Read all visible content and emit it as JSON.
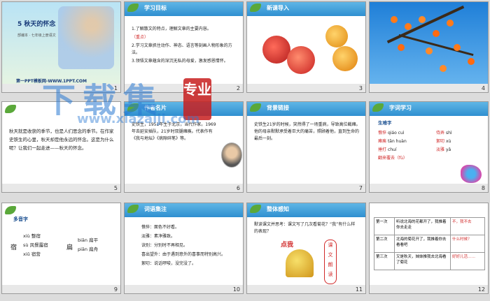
{
  "slides": {
    "s1": {
      "title": "5 秋天的怀念",
      "subtitle": "部编本 · 七年级上册语文",
      "url": "第一PPT模板网-WWW.1PPT.COM",
      "num": "1"
    },
    "s2": {
      "header": "学习目标",
      "items": [
        "1.了解散文的特点，理解文章的主要内容。",
        "2.学习文章抓住动作、神态、语言等刻画人物形象的方法。",
        "3.领悟文章蕴含的深沉无私的母爱，激发感恩情怀。"
      ],
      "mark": "（重点）",
      "num": "2"
    },
    "s3": {
      "header": "新课导入",
      "num": "3"
    },
    "s4": {
      "num": "4"
    },
    "s5": {
      "text": "秋天就是收获的季节，也是人们思念的季节。在作家史铁生的心里，秋天却是他永远的怀念。这是为什么呢？让我们一起走进——秋天的怀念。",
      "num": "5"
    },
    "s6": {
      "header": "作者名片",
      "text": "史铁生，1951年生于北京，当代作家。1969年去延安插队，21岁时双腿瘫痪。代表作有《我与地坛》《病隙碎笔》等。",
      "num": "6"
    },
    "s7": {
      "header": "背景链接",
      "text": "史铁生21岁的时候，突然得了一场重病，导致高位截瘫。他的母亲默默承受着巨大的痛苦，照顾着他，直到生命的最后一刻。",
      "num": "7"
    },
    "s8": {
      "header": "字词学习",
      "subheader": "生难字",
      "pairs": [
        [
          "憔悴",
          "qiáo cuì"
        ],
        [
          "瘫痪",
          "tān huàn"
        ],
        [
          "捶打",
          "chuí"
        ],
        [
          "侍弄",
          "shì"
        ],
        [
          "絮叨",
          "xù"
        ],
        [
          "淡雅",
          "yǎ"
        ]
      ],
      "extra": "翻来覆去（fù）",
      "num": "8"
    },
    "s9": {
      "header": "多音字",
      "rows": [
        "xiù 整宿",
        "sù 风餐露宿",
        "xiǔ 宿营"
      ],
      "right": [
        "biān 扁平",
        "piān 扁舟"
      ],
      "num": "9"
    },
    "s10": {
      "header": "词语集注",
      "items": [
        "憔悴：面色不好看。",
        "淡雅：素净雅致。",
        "诀别：分别时不再相见。",
        "喜出望外：由于遇到意外的喜事而特别高兴。",
        "絮叨：说话啰唆，没完没了。"
      ],
      "num": "10"
    },
    "s11": {
      "header": "整体感知",
      "question": "默读课文并思考：课文写了几次看菊花？“我”有什么样的表现？",
      "stamp": "点我",
      "side": [
        "课",
        "文",
        "朗",
        "读"
      ],
      "num": "11"
    },
    "s12": {
      "rows": [
        {
          "k": "第一次",
          "v": "听说北海的花都开了，我推着你去走走",
          "r": "不，我不去"
        },
        {
          "k": "第二次",
          "v": "北海的菊花开了，我推着你去看看吧",
          "r": "什么时候？"
        },
        {
          "k": "第三次",
          "v": "又是秋天，妹妹推我去北海看了菊花",
          "r": "好好儿活……"
        }
      ],
      "num": "12"
    },
    "watermark": {
      "big": "下载集",
      "badge": "专业",
      "url": "www.xiazaiji.com"
    },
    "colors": {
      "accent": "#2f8fd0",
      "red": "#d12a2a",
      "green": "#5aa83a"
    }
  }
}
